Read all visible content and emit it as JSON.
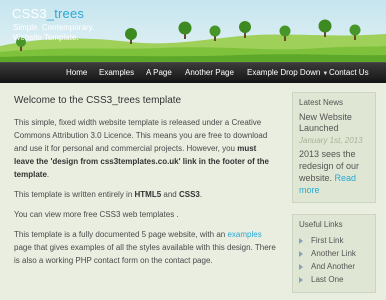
{
  "header": {
    "logo_main": "CSS3",
    "logo_accent": "_trees",
    "slogan": "Simple. Contemporary. Website Template."
  },
  "nav": {
    "items": [
      "Home",
      "Examples",
      "A Page",
      "Another Page",
      "Example Drop Down",
      "Contact Us"
    ]
  },
  "main": {
    "heading": "Welcome to the CSS3_trees template",
    "p1_a": "This simple, fixed width website template is released under a Creative Commons Attribution 3.0 Licence. This means you are free to download and use it for personal and commercial projects. However, you ",
    "p1_b": "must leave the 'design from css3templates.co.uk' link in the footer of the template",
    "p1_c": ".",
    "p2_a": "This template is written entirely in ",
    "p2_b": "HTML5",
    "p2_c": " and ",
    "p2_d": "CSS3",
    "p2_e": ".",
    "p3": "You can view more free CSS3 web templates .",
    "p4_a": "This template is a fully documented 5 page website, with an ",
    "p4_link": "examples",
    "p4_b": " page that gives examples of all the styles available with this design. There is also a working PHP contact form on the contact page."
  },
  "sidebar": {
    "news_title": "Latest News",
    "news_headline": "New Website Launched",
    "news_date": "January 1st, 2013",
    "news_body": "2013 sees the redesign of our website. ",
    "news_read_more": "Read more",
    "links_title": "Useful Links",
    "links": [
      "First Link",
      "Another Link",
      "And Another",
      "Last One"
    ]
  },
  "colors": {
    "accent": "#2aa9d5",
    "nav_bg": "#1e1e1e",
    "page_bg": "#e9eee1",
    "panel_bg": "#dfe6d3"
  }
}
